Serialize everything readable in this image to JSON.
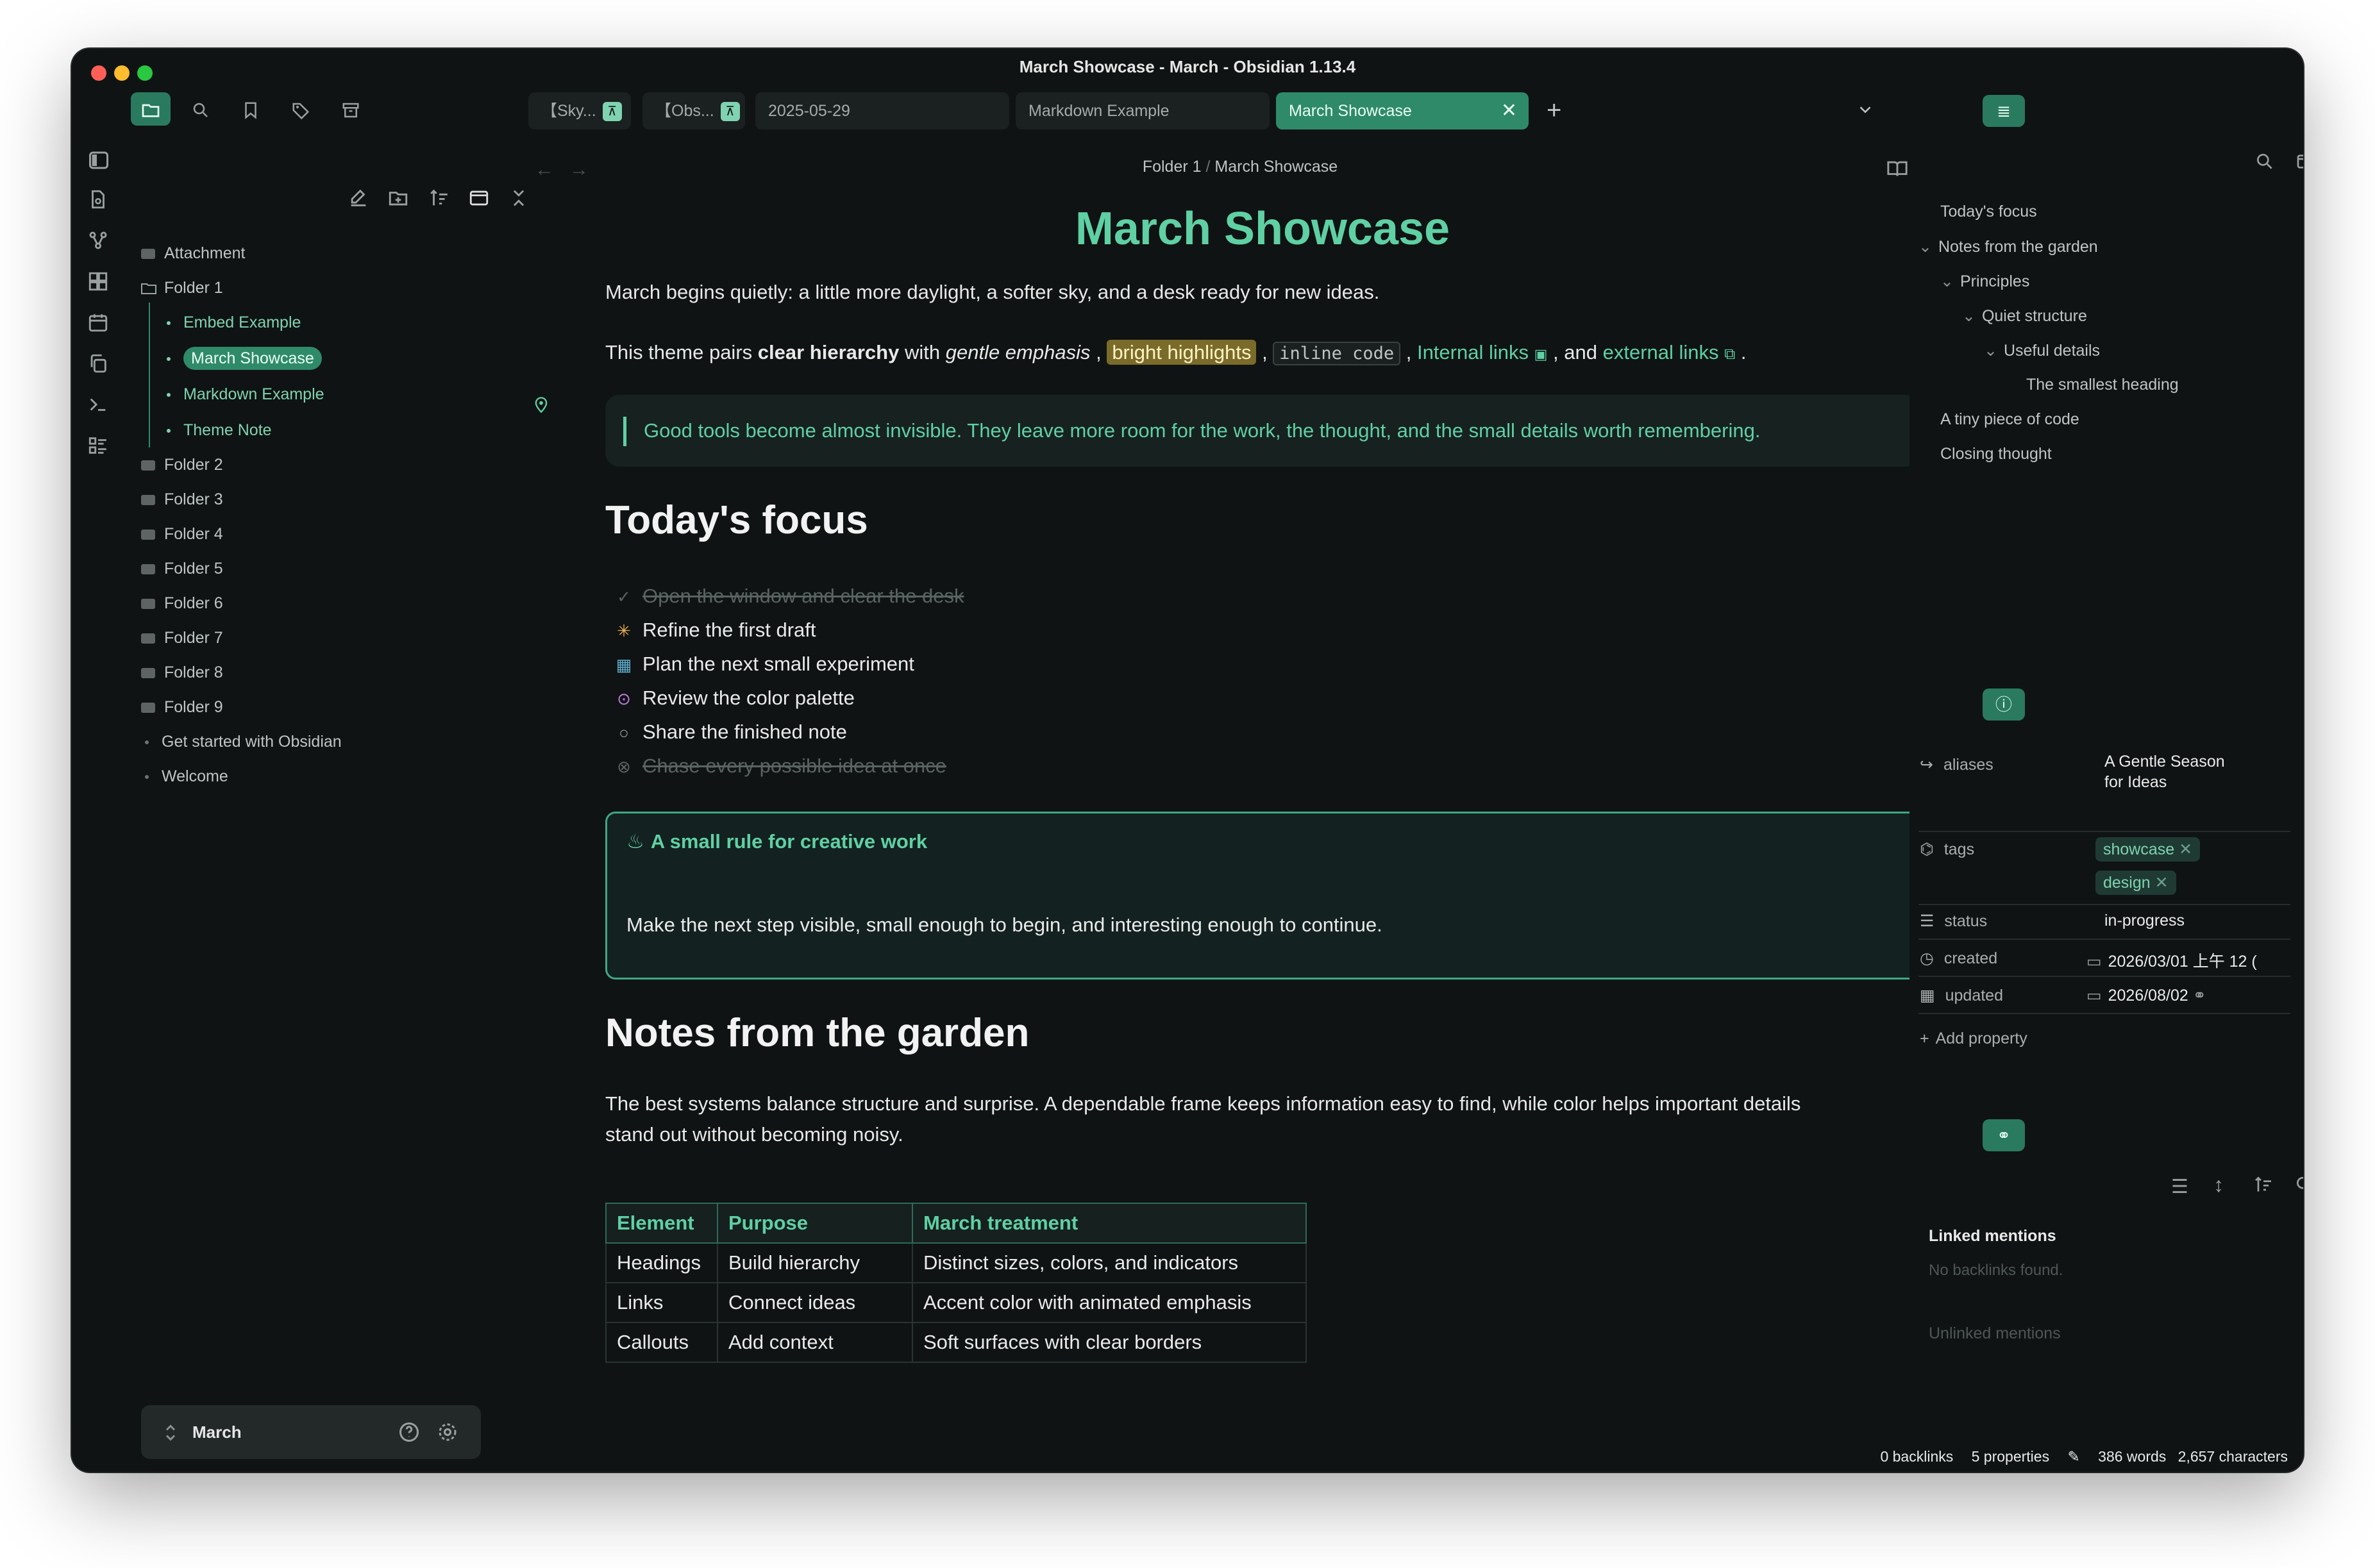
{
  "window": {
    "title": "March Showcase - March - Obsidian 1.13.4"
  },
  "left_sidebar": {
    "tree": [
      {
        "label": "Attachment",
        "type": "folder"
      },
      {
        "label": "Folder 1",
        "type": "folder-open"
      },
      {
        "label": "Embed Example",
        "type": "file"
      },
      {
        "label": "March Showcase",
        "type": "file-active"
      },
      {
        "label": "Markdown Example",
        "type": "file"
      },
      {
        "label": "Theme Note",
        "type": "file"
      },
      {
        "label": "Folder 2",
        "type": "folder"
      },
      {
        "label": "Folder 3",
        "type": "folder"
      },
      {
        "label": "Folder 4",
        "type": "folder"
      },
      {
        "label": "Folder 5",
        "type": "folder"
      },
      {
        "label": "Folder 6",
        "type": "folder"
      },
      {
        "label": "Folder 7",
        "type": "folder"
      },
      {
        "label": "Folder 8",
        "type": "folder"
      },
      {
        "label": "Folder 9",
        "type": "folder"
      },
      {
        "label": "Get started with Obsidian",
        "type": "root-file"
      },
      {
        "label": "Welcome",
        "type": "root-file"
      }
    ],
    "vault_name": "March"
  },
  "tabs": [
    {
      "label": "【Sky..."
    },
    {
      "label": "【Obs..."
    },
    {
      "label": "2025-05-29"
    },
    {
      "label": "Markdown Example"
    },
    {
      "label": "March Showcase"
    }
  ],
  "breadcrumb": {
    "folder": "Folder 1",
    "sep": "/",
    "note": "March Showcase"
  },
  "note": {
    "title": "March Showcase",
    "intro": "March begins quietly: a little more daylight, a softer sky, and a desk ready for new ideas.",
    "theme_line": {
      "prefix": "This theme pairs ",
      "bold": "clear hierarchy",
      "mid1": " with ",
      "italic": "gentle emphasis",
      "mid2": " , ",
      "highlight": "bright highlights",
      "mid3": " , ",
      "code": "inline code",
      "mid4": " , ",
      "internal": "Internal links",
      "mid5": " , and ",
      "external": "external links",
      "end": " ."
    },
    "quote": "Good tools become almost invisible. They leave more room for the work, the thought, and the small details worth remembering.",
    "h_focus": "Today's focus",
    "tasks": [
      {
        "text": "Open the window and clear the desk",
        "state": "done"
      },
      {
        "text": "Refine the first draft",
        "state": "progress"
      },
      {
        "text": "Plan the next small experiment",
        "state": "scheduled"
      },
      {
        "text": "Review the color palette",
        "state": "review"
      },
      {
        "text": "Share the finished note",
        "state": "todo"
      },
      {
        "text": "Chase every possible idea at once",
        "state": "cancelled"
      }
    ],
    "callout_title": "A small rule for creative work",
    "callout_body": "Make the next step visible, small enough to begin, and interesting enough to continue.",
    "h_garden": "Notes from the garden",
    "garden_p1": "The best systems balance structure and surprise. A dependable frame keeps information easy to find, while color helps important details",
    "garden_p2": "stand out without becoming noisy.",
    "table": {
      "headers": [
        "Element",
        "Purpose",
        "March treatment"
      ],
      "rows": [
        [
          "Headings",
          "Build hierarchy",
          "Distinct sizes, colors, and indicators"
        ],
        [
          "Links",
          "Connect ideas",
          "Accent color with animated emphasis"
        ],
        [
          "Callouts",
          "Add context",
          "Soft surfaces with clear borders"
        ]
      ]
    }
  },
  "outline": [
    {
      "label": "Today's focus",
      "depth": 0,
      "chev": false
    },
    {
      "label": "Notes from the garden",
      "depth": 0,
      "chev": true
    },
    {
      "label": "Principles",
      "depth": 1,
      "chev": true
    },
    {
      "label": "Quiet structure",
      "depth": 2,
      "chev": true
    },
    {
      "label": "Useful details",
      "depth": 3,
      "chev": true
    },
    {
      "label": "The smallest heading",
      "depth": 4,
      "chev": false
    },
    {
      "label": "A tiny piece of code",
      "depth": 0,
      "chev": false
    },
    {
      "label": "Closing thought",
      "depth": 0,
      "chev": false
    }
  ],
  "properties": {
    "aliases_label": "aliases",
    "aliases_value_1": "A Gentle Season",
    "aliases_value_2": "for Ideas",
    "tags_label": "tags",
    "tags": [
      "showcase",
      "design"
    ],
    "status_label": "status",
    "status_value": "in-progress",
    "created_label": "created",
    "created_value": "2026/03/01 上午 12 (",
    "updated_label": "updated",
    "updated_value": "2026/08/02",
    "add_property": "Add property"
  },
  "backlinks": {
    "linked": "Linked mentions",
    "linked_count": "0",
    "none": "No backlinks found.",
    "unlinked": "Unlinked mentions"
  },
  "status": {
    "backlinks": "0 backlinks",
    "properties": "5 properties",
    "words": "386 words",
    "chars": "2,657 characters"
  },
  "colors": {
    "accent": "#5fd0a4",
    "accent_strong": "#2f8a69",
    "background": "#0f1313"
  }
}
